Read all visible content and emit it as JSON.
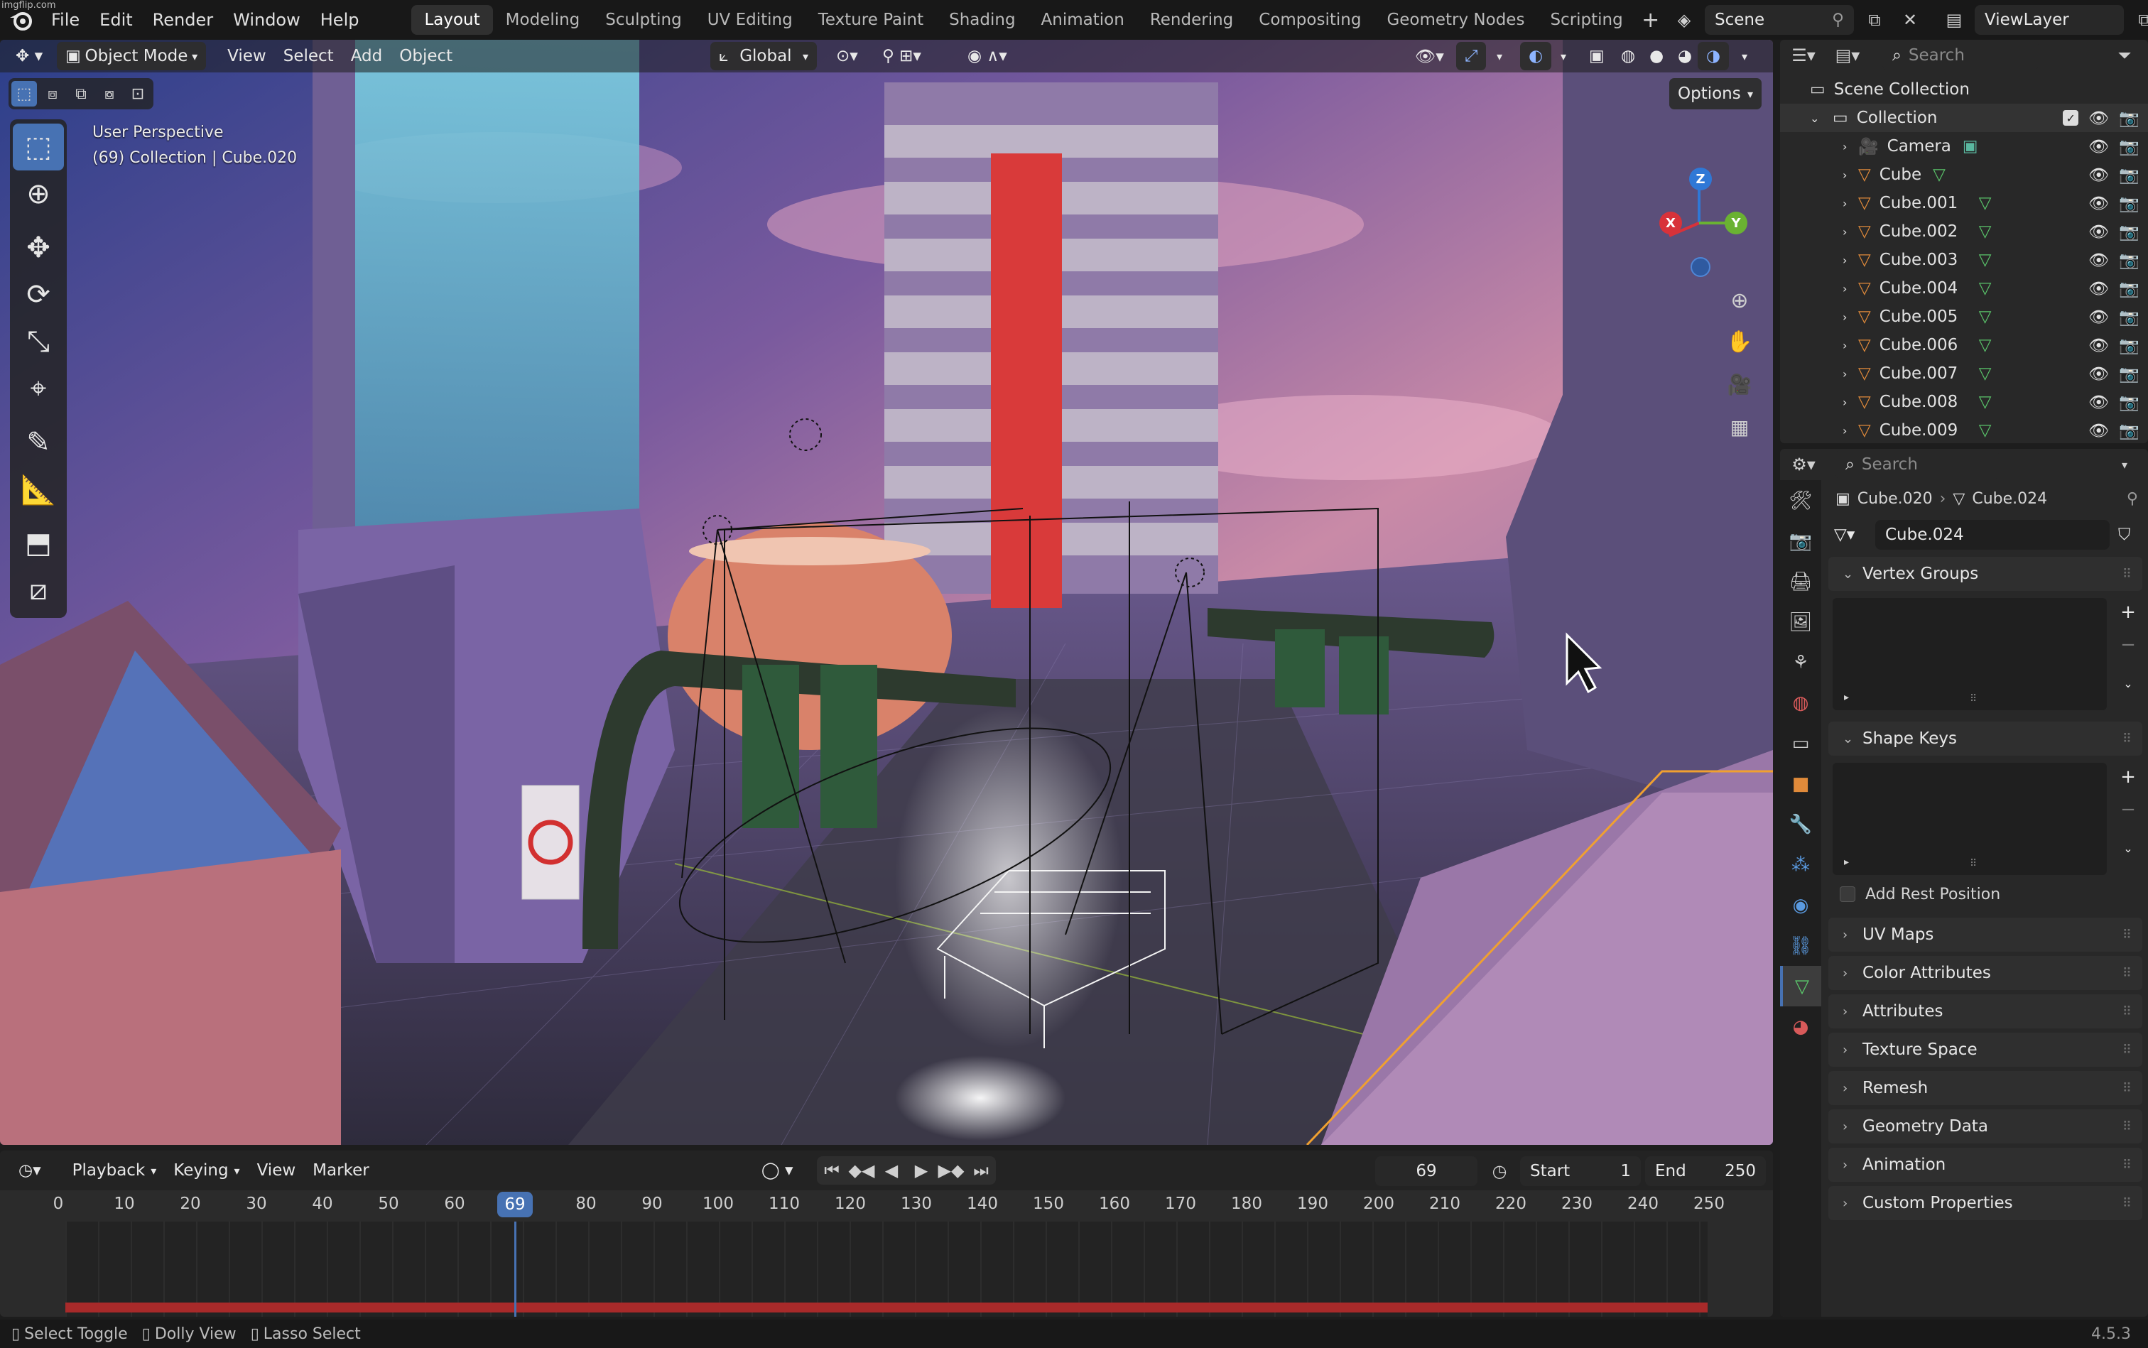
{
  "app": {
    "version": "4.5.3",
    "watermark": "imgflip.com"
  },
  "menu": {
    "items": [
      "File",
      "Edit",
      "Render",
      "Window",
      "Help"
    ]
  },
  "workspaces": [
    "Layout",
    "Modeling",
    "Sculpting",
    "UV Editing",
    "Texture Paint",
    "Shading",
    "Animation",
    "Rendering",
    "Compositing",
    "Geometry Nodes",
    "Scripting"
  ],
  "active_workspace": "Layout",
  "scene": {
    "name": "Scene",
    "view_layer": "ViewLayer"
  },
  "viewport": {
    "mode": "Object Mode",
    "menus": [
      "View",
      "Select",
      "Add",
      "Object"
    ],
    "transform_orientation": "Global",
    "options_label": "Options",
    "overlay_title": "User Perspective",
    "overlay_subtitle": "(69) Collection | Cube.020",
    "gizmo_axes": {
      "x": "X",
      "y": "Y",
      "z": "Z"
    }
  },
  "outliner": {
    "search_placeholder": "Search",
    "root": "Scene Collection",
    "collection": "Collection",
    "items": [
      "Camera",
      "Cube",
      "Cube.001",
      "Cube.002",
      "Cube.003",
      "Cube.004",
      "Cube.005",
      "Cube.006",
      "Cube.007",
      "Cube.008",
      "Cube.009"
    ]
  },
  "properties": {
    "search_placeholder": "Search",
    "breadcrumb_object": "Cube.020",
    "breadcrumb_data": "Cube.024",
    "mesh_name": "Cube.024",
    "panels": {
      "vertex_groups": "Vertex Groups",
      "shape_keys": "Shape Keys",
      "add_rest_position": "Add Rest Position",
      "collapsed": [
        "UV Maps",
        "Color Attributes",
        "Attributes",
        "Texture Space",
        "Remesh",
        "Geometry Data",
        "Animation",
        "Custom Properties"
      ]
    }
  },
  "timeline": {
    "menus": [
      "Playback",
      "Keying",
      "View",
      "Marker"
    ],
    "current_frame": "69",
    "start_label": "Start",
    "start": "1",
    "end_label": "End",
    "end": "250",
    "ruler": [
      "0",
      "10",
      "20",
      "30",
      "40",
      "50",
      "60",
      "80",
      "90",
      "100",
      "110",
      "120",
      "130",
      "140",
      "150",
      "160",
      "170",
      "180",
      "190",
      "200",
      "210",
      "220",
      "230",
      "240",
      "250"
    ]
  },
  "statusbar": {
    "items": [
      "Select Toggle",
      "Dolly View",
      "Lasso Select"
    ]
  },
  "colors": {
    "accent": "#4772b3",
    "selection": "#f0a030",
    "timeline_range": "#a82a2a"
  }
}
